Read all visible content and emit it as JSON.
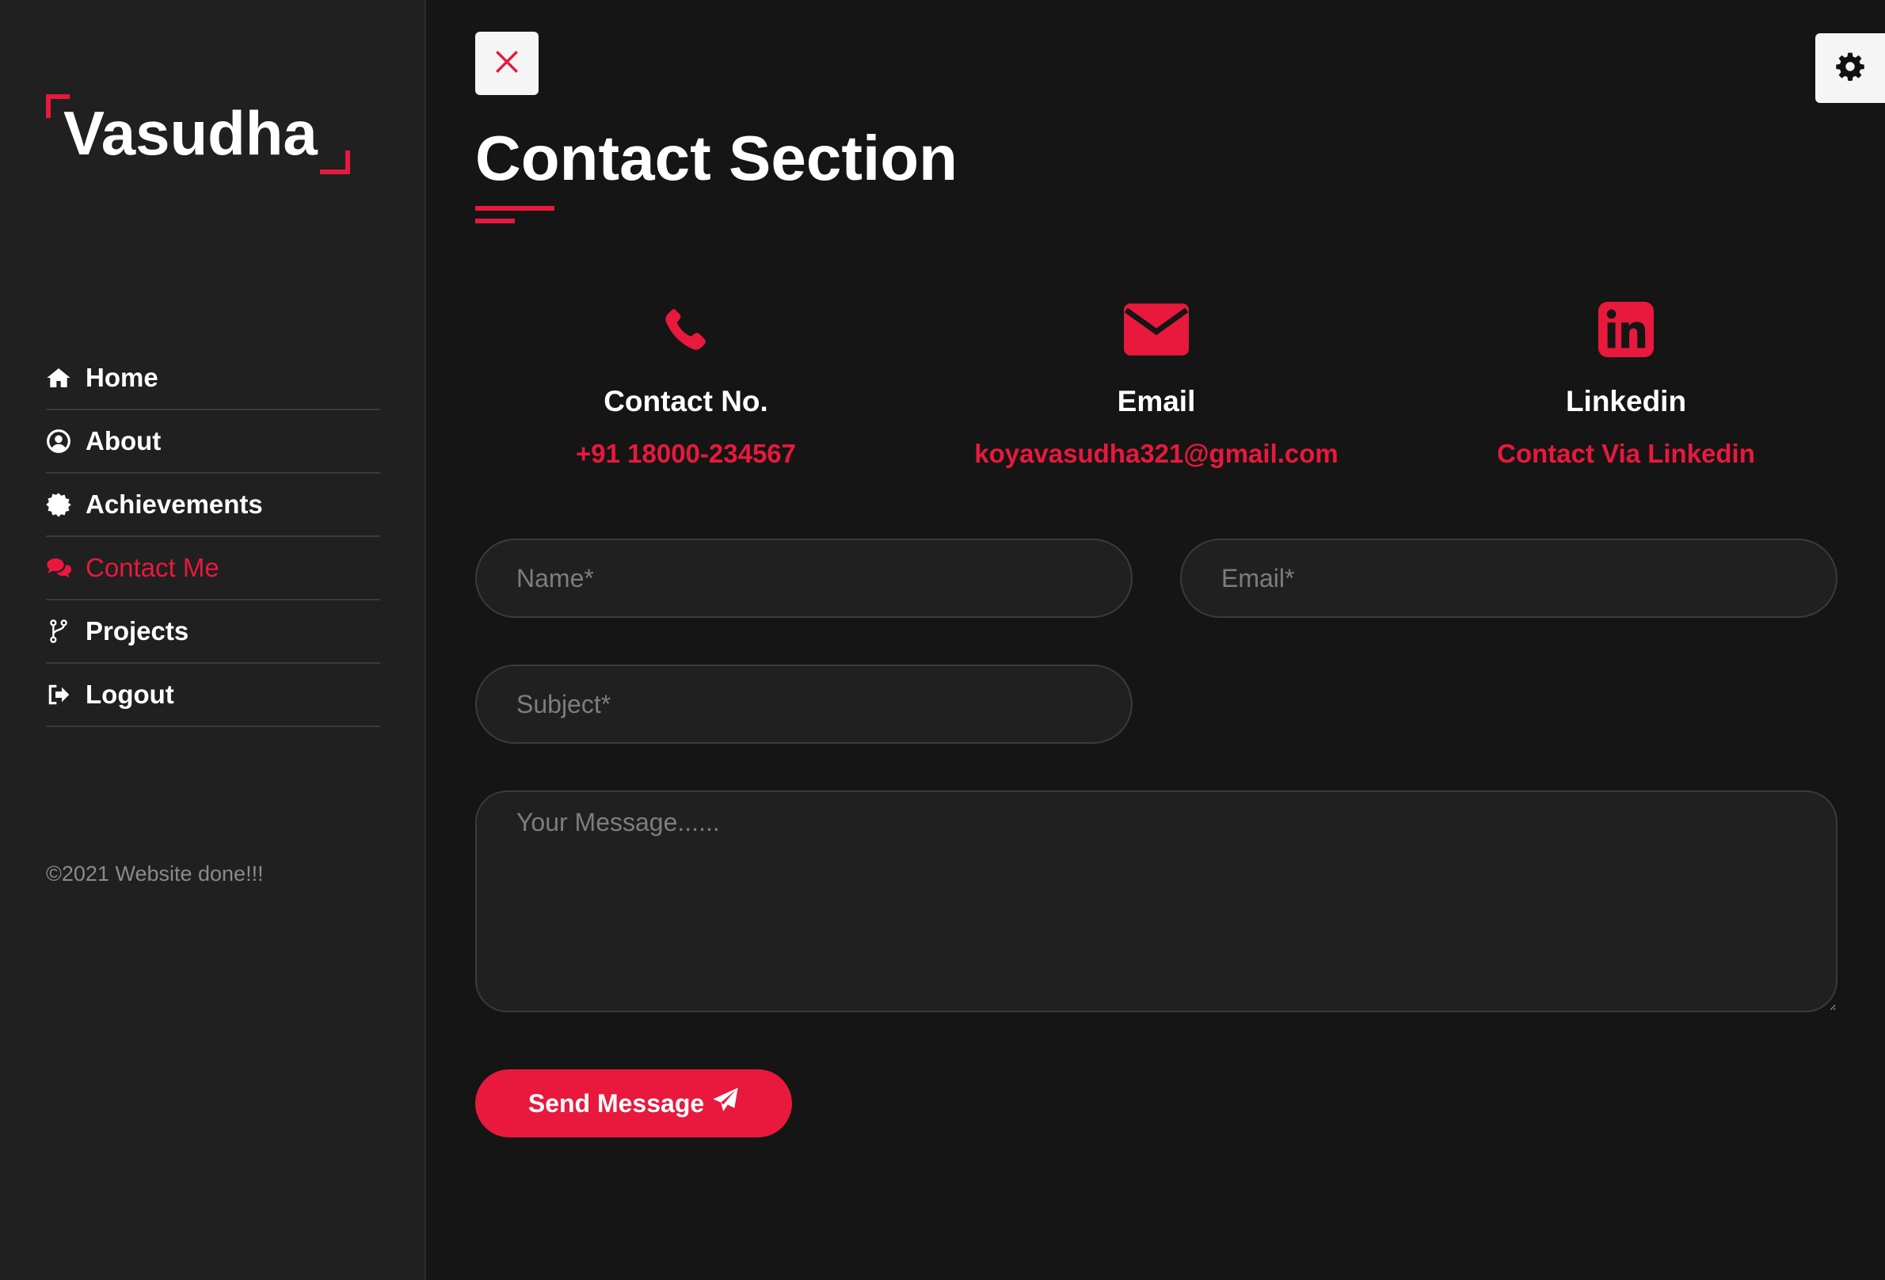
{
  "sidebar": {
    "logo_text": "Vasudha",
    "items": [
      {
        "label": "Home",
        "icon": "home-icon"
      },
      {
        "label": "About",
        "icon": "user-circle-icon"
      },
      {
        "label": "Achievements",
        "icon": "badge-icon"
      },
      {
        "label": "Contact Me",
        "icon": "chat-icon",
        "active": true
      },
      {
        "label": "Projects",
        "icon": "code-branch-icon"
      },
      {
        "label": "Logout",
        "icon": "logout-icon"
      }
    ],
    "copyright": "©2021 Website done!!!"
  },
  "main": {
    "title": "Contact Section",
    "contacts": [
      {
        "icon": "phone-icon",
        "title": "Contact No.",
        "value": "+91 18000-234567"
      },
      {
        "icon": "envelope-icon",
        "title": "Email",
        "value": "koyavasudha321@gmail.com"
      },
      {
        "icon": "linkedin-icon",
        "title": "Linkedin",
        "value": "Contact Via Linkedin"
      }
    ],
    "form": {
      "name_placeholder": "Name*",
      "email_placeholder": "Email*",
      "subject_placeholder": "Subject*",
      "message_placeholder": "Your Message......",
      "send_label": "Send Message"
    }
  },
  "colors": {
    "accent": "#e8193c",
    "background": "#151515",
    "sidebar": "#202020"
  }
}
